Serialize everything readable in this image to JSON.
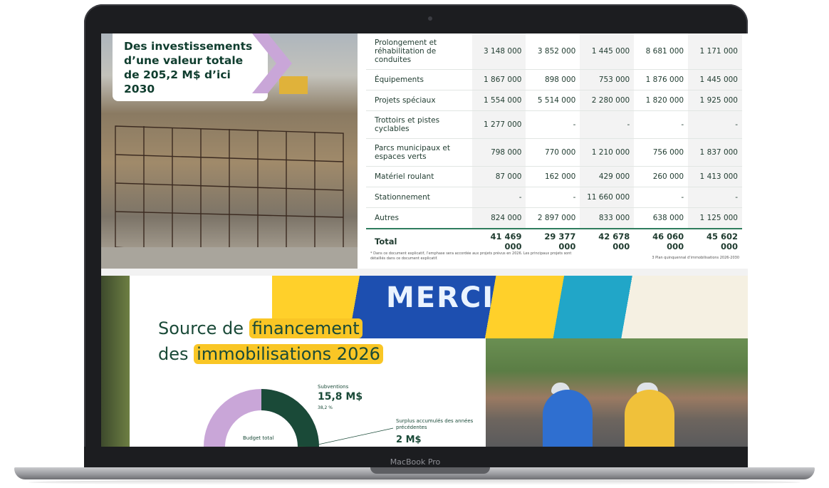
{
  "device": {
    "brand_label": "MacBook Pro"
  },
  "slide1": {
    "title": "Des investissements d’une valeur totale de 205,2 M$ d’ici 2030",
    "table": {
      "rows": [
        {
          "label": "Prolongement et réhabilitation de conduites",
          "values": [
            "3 148 000",
            "3 852 000",
            "1 445 000",
            "8 681 000",
            "1 171 000"
          ]
        },
        {
          "label": "Équipements",
          "values": [
            "1 867 000",
            "898 000",
            "753 000",
            "1 876 000",
            "1 445 000"
          ]
        },
        {
          "label": "Projets spéciaux",
          "values": [
            "1 554 000",
            "5 514 000",
            "2 280 000",
            "1 820 000",
            "1 925 000"
          ]
        },
        {
          "label": "Trottoirs et pistes cyclables",
          "values": [
            "1 277 000",
            "-",
            "-",
            "-",
            "-"
          ]
        },
        {
          "label": "Parcs municipaux et espaces verts",
          "values": [
            "798 000",
            "770 000",
            "1 210 000",
            "756 000",
            "1 837 000"
          ]
        },
        {
          "label": "Matériel roulant",
          "values": [
            "87 000",
            "162 000",
            "429 000",
            "260 000",
            "1 413 000"
          ]
        },
        {
          "label": "Stationnement",
          "values": [
            "-",
            "-",
            "11 660 000",
            "-",
            "-"
          ]
        },
        {
          "label": "Autres",
          "values": [
            "824 000",
            "2 897 000",
            "833 000",
            "638 000",
            "1 125 000"
          ]
        }
      ],
      "total": {
        "label": "Total",
        "values": [
          "41 469 000",
          "29 377 000",
          "42 678 000",
          "46 060 000",
          "45 602 000"
        ]
      }
    },
    "footnote": "* Dans ce document explicatif, l’emphase sera accordée aux projets prévus en 2026. Les principaux projets sont détaillés dans ce document explicatif.",
    "page_footer": "3 Plan quinquennal d’immobilisations 2026-2030"
  },
  "slide2": {
    "banner_text": "MERCI",
    "title_line1_plain": "Source de ",
    "title_line1_highlight": "financement",
    "title_line2_plain": "des ",
    "title_line2_highlight": "immobilisations 2026",
    "donut_center_label": "Budget total",
    "subventions": {
      "label": "Subventions",
      "amount": "15,8 M$",
      "percent": "38,2 %"
    },
    "surplus": {
      "label": "Surplus accumulés des années précédentes",
      "amount": "2 M$"
    }
  },
  "colors": {
    "dark_green": "#0f3d2e",
    "accent_green": "#2f7d5d",
    "highlight_yellow": "#f9c625",
    "lilac": "#c9a6d8"
  }
}
